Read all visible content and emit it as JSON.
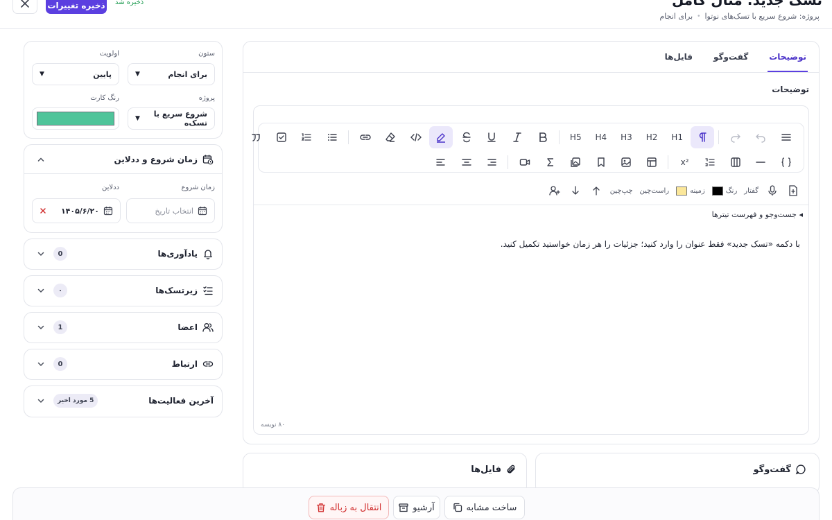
{
  "header": {
    "title": "تسک جدید: مثال کامل",
    "breadcrumb": {
      "project": "پروژه: شروع سریع با تسک‌های نوتوا",
      "separator": "•",
      "column": "برای انجام"
    },
    "save_label": "ذخیره تغییرات",
    "saved_note": "ذخیره شد"
  },
  "tabs": [
    {
      "label": "توضیحات",
      "active": true
    },
    {
      "label": "گفت‌وگو",
      "active": false
    },
    {
      "label": "فایل‌ها",
      "active": false
    }
  ],
  "editor": {
    "section_label": "توضیحات",
    "heading_buttons": [
      "H1",
      "H2",
      "H3",
      "H4",
      "H5"
    ],
    "superscript_label": "x²",
    "row3": {
      "speech": "گفتار",
      "color": "رنگ",
      "background": "زمینه",
      "rtl": "راست‌چین",
      "ltr": "چپ‌چین",
      "text_color": "#000000",
      "bg_color": "#fbe79a"
    },
    "toc_label": "جست‌وجو و فهرست تیترها",
    "toc_arrow": "◂",
    "body": "با دکمه «تسک جدید» فقط عنوان را وارد کنید؛ جزئیات را هر زمان خواستید تکمیل کنید.",
    "char_count": "۸۰ نویسه"
  },
  "bottom_cards": {
    "chat_title": "گفت‌وگو",
    "files_title": "فایل‌ها"
  },
  "actions": {
    "duplicate": "ساخت مشابه",
    "archive": "آرشیو",
    "trash": "انتقال به زباله"
  },
  "sidebar": {
    "column_label": "ستون",
    "column_value": "برای انجام",
    "priority_label": "اولویت",
    "priority_value": "پایین",
    "project_label": "پروژه",
    "project_value": "شروع سریع با تسک‌ه",
    "card_color_label": "رنگ کارت",
    "card_color": "#4fc49a",
    "dates": {
      "title": "زمان شروع و ددلاین",
      "start_label": "زمان شروع",
      "start_placeholder": "انتخاب تاریخ",
      "deadline_label": "ددلاین",
      "deadline_value": "۱۴۰۵/۶/۲۰"
    },
    "sections": [
      {
        "title": "یادآوری‌ها",
        "badge": "0"
      },
      {
        "title": "زیرتسک‌ها",
        "badge": "۰"
      },
      {
        "title": "اعضا",
        "badge": "1"
      },
      {
        "title": "ارتباط",
        "badge": "0"
      },
      {
        "title": "آخرین فعالیت‌ها",
        "badge": "5 مورد اخیر"
      }
    ]
  },
  "colors": {
    "accent": "#5b3fe0",
    "danger": "#d12f2f",
    "success": "#1c9a4f"
  }
}
